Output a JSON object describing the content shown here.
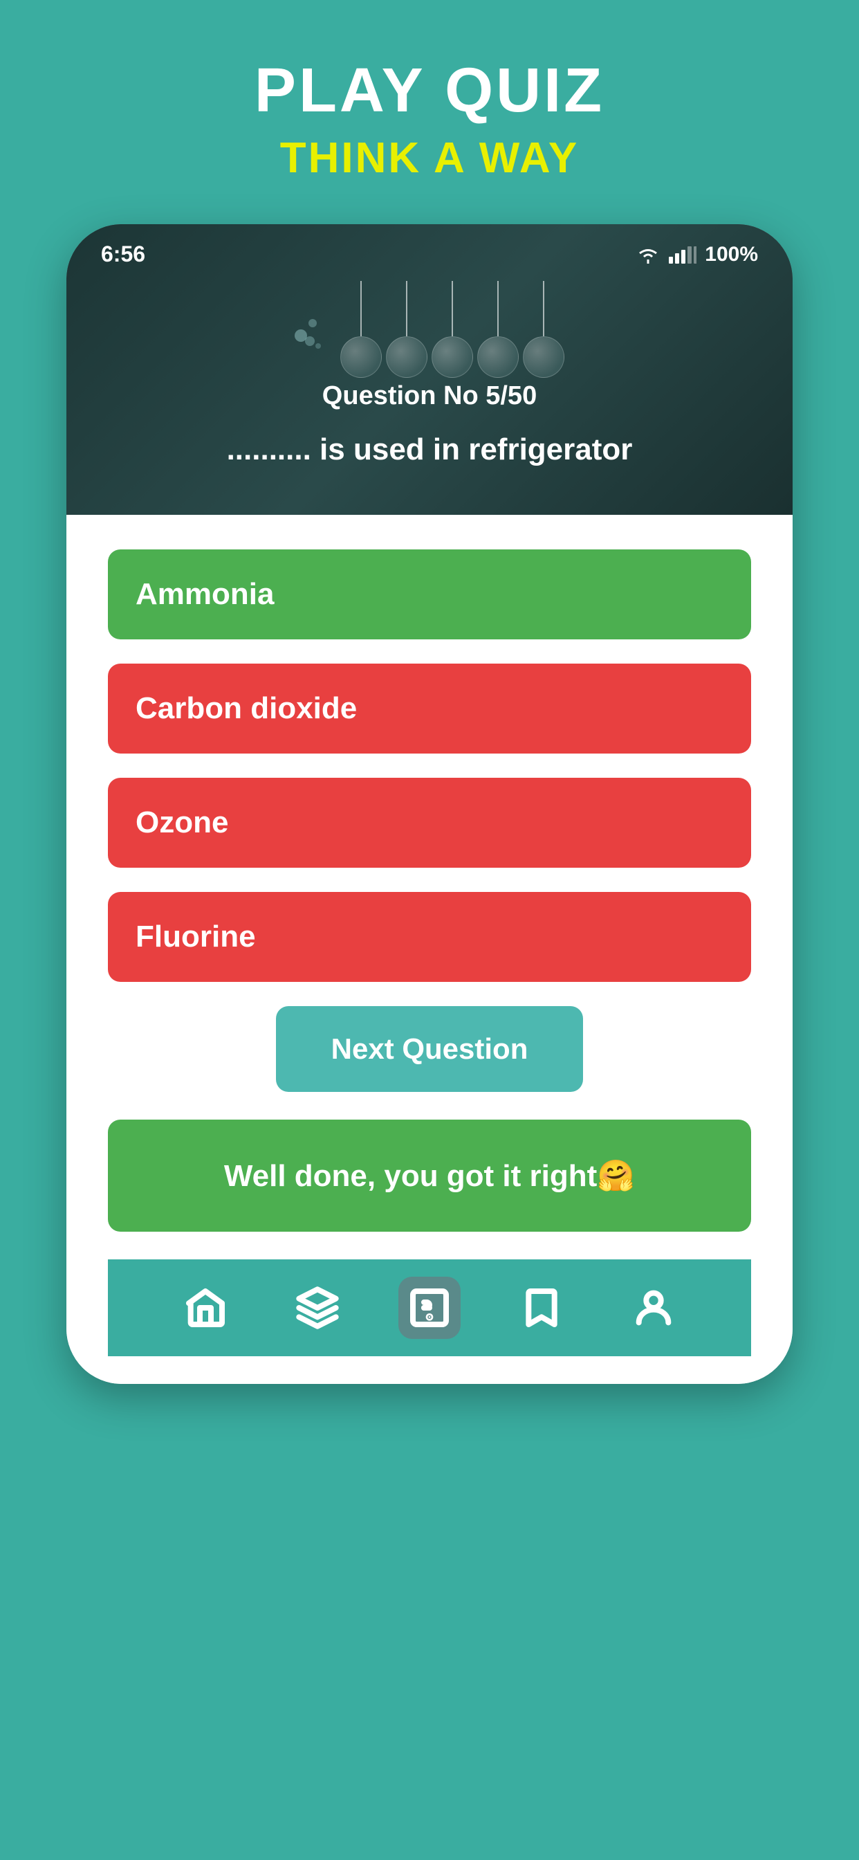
{
  "page": {
    "title": "PLAY QUIZ",
    "subtitle": "THINK A WAY"
  },
  "status_bar": {
    "time": "6:56",
    "battery": "100%",
    "wifi_icon": "wifi",
    "signal_icon": "signal"
  },
  "question": {
    "number_label": "Question No 5/50",
    "text": ".......... is used in refrigerator"
  },
  "answers": [
    {
      "id": "a",
      "text": "Ammonia",
      "state": "correct"
    },
    {
      "id": "b",
      "text": "Carbon dioxide",
      "state": "wrong"
    },
    {
      "id": "c",
      "text": "Ozone",
      "state": "wrong"
    },
    {
      "id": "d",
      "text": "Fluorine",
      "state": "wrong"
    }
  ],
  "next_button_label": "Next Question",
  "feedback": {
    "text": "Well done, you got it right🤗"
  },
  "nav": {
    "items": [
      {
        "id": "home",
        "icon": "home",
        "active": false
      },
      {
        "id": "help",
        "icon": "help",
        "active": false
      },
      {
        "id": "quiz",
        "icon": "quiz",
        "active": true
      },
      {
        "id": "bookmark",
        "icon": "bookmark",
        "active": false
      },
      {
        "id": "profile",
        "icon": "profile",
        "active": false
      }
    ]
  },
  "colors": {
    "background": "#3aada0",
    "correct": "#4caf50",
    "wrong": "#e84040",
    "next_btn": "#4db8b0",
    "nav_active": "#5a8a8a"
  }
}
